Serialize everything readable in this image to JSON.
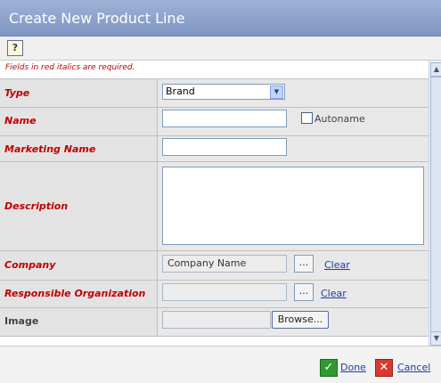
{
  "window": {
    "title": "Create New Product Line"
  },
  "toolbar": {
    "help_glyph": "?"
  },
  "form": {
    "required_note": "Fields in red italics are required.",
    "type": {
      "label": "Type",
      "value": "Brand"
    },
    "name": {
      "label": "Name",
      "value": "",
      "autoname_label": "Autoname",
      "autoname_checked": false
    },
    "marketing_name": {
      "label": "Marketing Name",
      "value": ""
    },
    "description": {
      "label": "Description",
      "value": ""
    },
    "company": {
      "label": "Company",
      "value": "Company Name",
      "browse_label": "...",
      "clear_label": "Clear"
    },
    "responsible_org": {
      "label": "Responsible Organization",
      "value": "",
      "browse_label": "...",
      "clear_label": "Clear"
    },
    "image": {
      "label": "Image",
      "value": "",
      "browse_label": "Browse..."
    }
  },
  "footer": {
    "done_label": "Done",
    "cancel_label": "Cancel"
  },
  "colors": {
    "title_bar": "#8a9ecb",
    "required_text": "#c00000",
    "link": "#1f3f9f",
    "done_icon": "#2e9a2e",
    "cancel_icon": "#d83a2e"
  }
}
